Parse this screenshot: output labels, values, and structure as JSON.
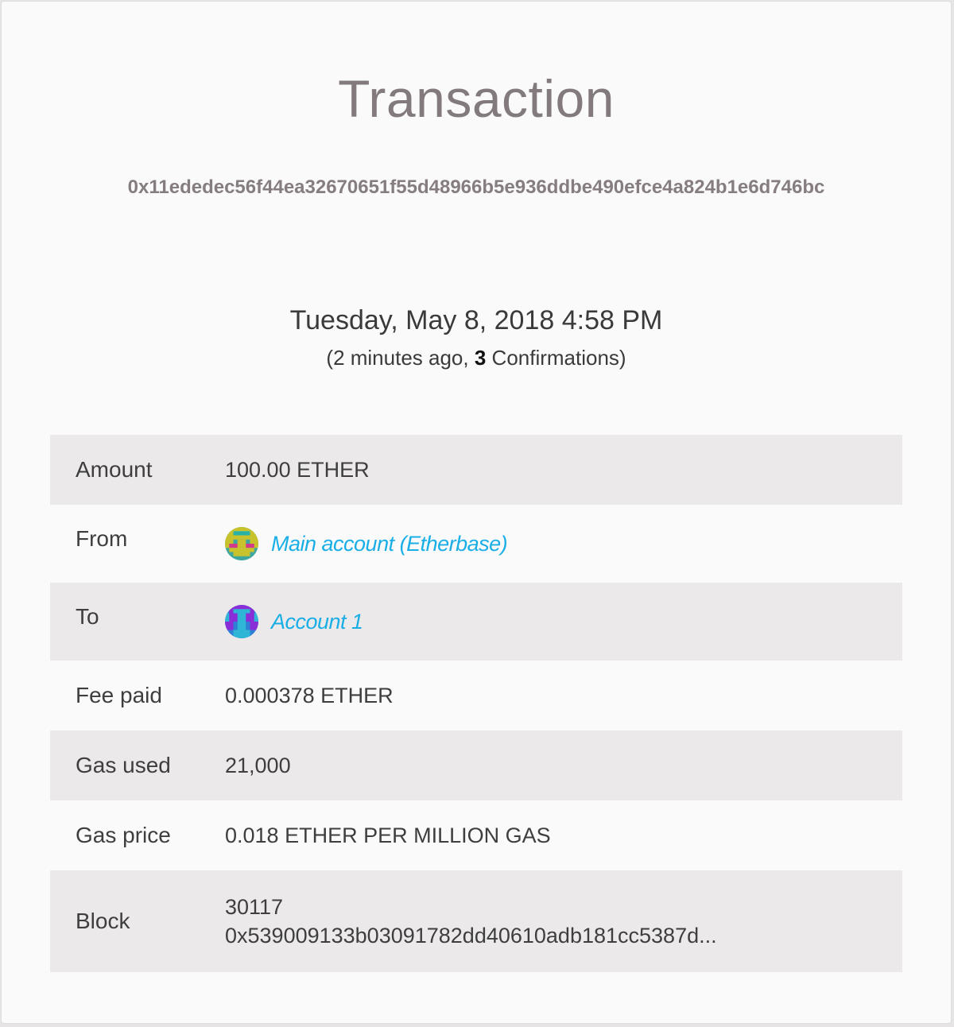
{
  "page": {
    "title": "Transaction",
    "tx_hash": "0x11ededec56f44ea32670651f55d48966b5e936ddbe490efce4a824b1e6d746bc",
    "date": "Tuesday, May 8, 2018 4:58 PM",
    "relative_time_prefix": "(2 minutes ago, ",
    "confirmations_count": "3",
    "confirmations_suffix": " Confirmations)"
  },
  "details": {
    "amount": {
      "label": "Amount",
      "value": "100.00 ETHER"
    },
    "from": {
      "label": "From",
      "value": "Main account (Etherbase)",
      "avatar_icon": "identicon-main-account"
    },
    "to": {
      "label": "To",
      "value": "Account 1",
      "avatar_icon": "identicon-account-1"
    },
    "fee": {
      "label": "Fee paid",
      "value": "0.000378 ETHER"
    },
    "gas_used": {
      "label": "Gas used",
      "value": "21,000"
    },
    "gas_price": {
      "label": "Gas price",
      "value": "0.018 ETHER PER MILLION GAS"
    },
    "block": {
      "label": "Block",
      "number": "30117",
      "hash": "0x539009133b03091782dd40610adb181cc5387d..."
    }
  },
  "colors": {
    "link": "#1aaee6",
    "row_shade": "#ece9ea",
    "title": "#827a7d"
  }
}
